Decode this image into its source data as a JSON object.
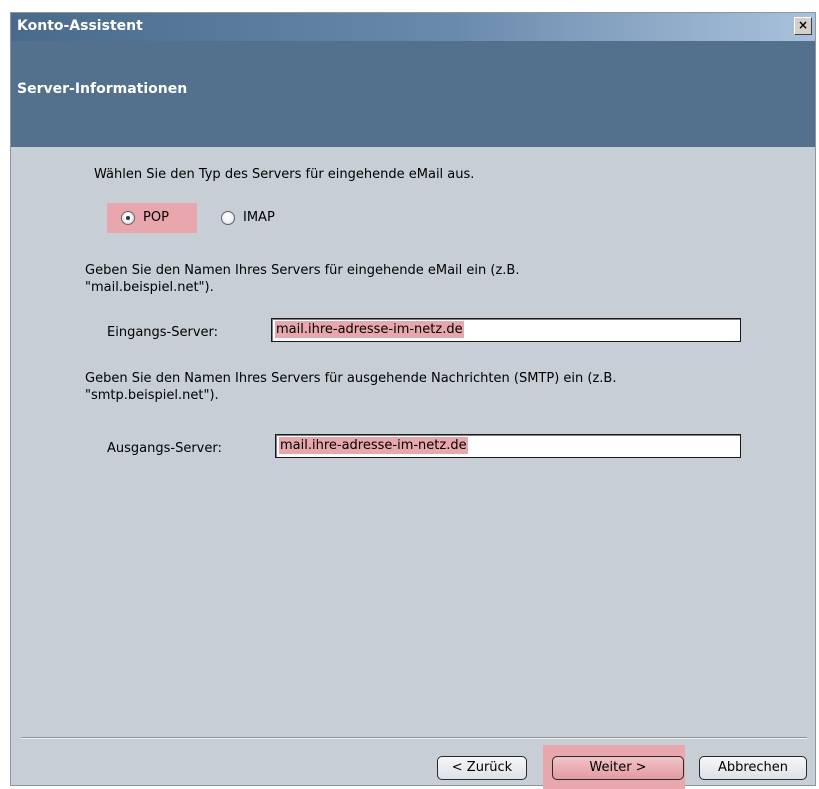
{
  "window": {
    "title": "Konto-Assistent",
    "close_glyph": "×",
    "close_icon": "close-icon"
  },
  "header": {
    "title": "Server-Informationen"
  },
  "incoming_type": {
    "prompt": "Wählen Sie den Typ des Servers für eingehende eMail aus.",
    "options": [
      {
        "label": "POP",
        "selected": true
      },
      {
        "label": "IMAP",
        "selected": false
      }
    ]
  },
  "incoming_server": {
    "instruction_line1": "Geben Sie den Namen Ihres Servers für eingehende eMail ein (z.B.",
    "instruction_line2": "\"mail.beispiel.net\").",
    "label": "Eingangs-Server:",
    "value": "mail.ihre-adresse-im-netz.de"
  },
  "outgoing_server": {
    "instruction_line1": "Geben Sie den Namen Ihres Servers für ausgehende Nachrichten (SMTP) ein (z.B.",
    "instruction_line2": "\"smtp.beispiel.net\").",
    "label": "Ausgangs-Server:",
    "value": "mail.ihre-adresse-im-netz.de"
  },
  "buttons": {
    "back": "< Zurück",
    "next": "Weiter >",
    "cancel": "Abbrechen"
  },
  "colors": {
    "highlight": "#e8a7ad",
    "header_bg": "#53708d",
    "panel_bg": "#c8ced6"
  }
}
